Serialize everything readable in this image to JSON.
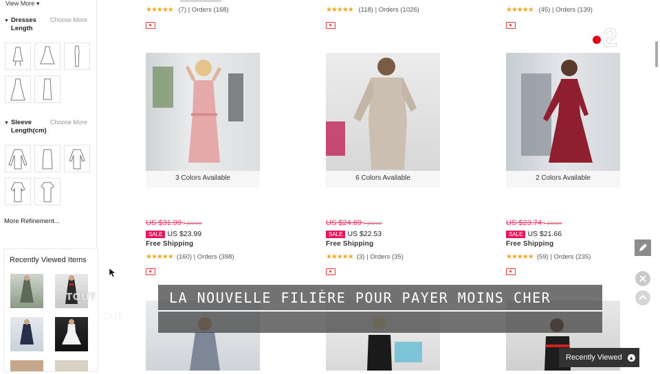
{
  "sidebar": {
    "view_more": "View More ▾",
    "filters": [
      {
        "title": "Dresses Length",
        "choose_more": "Choose More"
      },
      {
        "title": "Sleeve Length(cm)",
        "choose_more": "Choose More"
      }
    ],
    "more_refinement": "More Refinement...",
    "recently_viewed_title": "Recently Viewed Items"
  },
  "top_row": [
    {
      "stars": "★★★★★",
      "reviews": "(7)",
      "orders": "Orders (168)"
    },
    {
      "stars": "★★★★★",
      "reviews": "(118)",
      "orders": "Orders (1026)"
    },
    {
      "stars": "★★★★★",
      "reviews": "(45)",
      "orders": "Orders (139)"
    }
  ],
  "products": [
    {
      "colors": "3 Colors Available",
      "orig_price": "US $31.99",
      "per": "/ piece",
      "sale": "SALE",
      "sale_price": "US $23.99",
      "shipping": "Free Shipping",
      "stars": "★★★★★",
      "reviews": "(160)",
      "orders": "Orders (398)"
    },
    {
      "colors": "6 Colors Available",
      "orig_price": "US $24.69",
      "per": "/ piece",
      "sale": "SALE",
      "sale_price": "US $22.53",
      "shipping": "Free Shipping",
      "stars": "★★★★★",
      "reviews": "(3)",
      "orders": "Orders (35)"
    },
    {
      "colors": "2 Colors Available",
      "orig_price": "US $23.74",
      "per": "/ piece",
      "sale": "SALE",
      "sale_price": "US $21.66",
      "shipping": "Free Shipping",
      "stars": "★★★★★",
      "reviews": "(59)",
      "orders": "Orders (235)"
    }
  ],
  "overlay": {
    "tout": "TOUT",
    "tout2": "CUT",
    "banner": "LA NOUVELLE FILIÈRE POUR PAYER MOINS CHER"
  },
  "recently_viewed_tab": "Recently Viewed",
  "logo_text": "2",
  "colors": {
    "accent_red": "#e8175d",
    "star": "#f5a623",
    "logo_red": "#e2001a"
  }
}
